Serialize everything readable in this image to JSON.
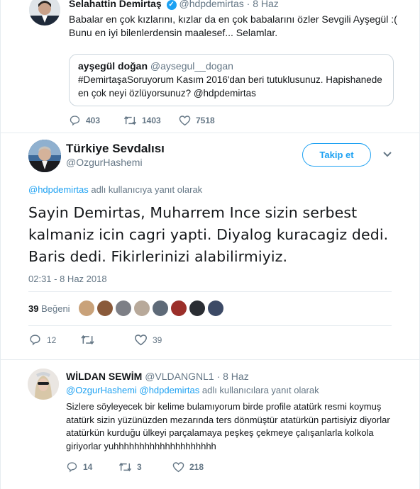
{
  "parent_tweet": {
    "name": "Selahattin Demirtaş",
    "verified_icon": "verified-badge-icon",
    "handle": "@hdpdemirtas",
    "date": "· 8 Haz",
    "text": "Babalar en çok kızlarını, kızlar da en çok babalarını özler Sevgili Ayşegül :( Bunu en iyi bilenlerdensin maalesef... Selamlar.",
    "quote": {
      "name": "ayşegül doğan",
      "handle": "@aysegul__dogan",
      "text": "#DemirtaşaSoruyorum Kasım 2016'dan beri tutuklusunuz. Hapishanede en çok neyi özlüyorsunuz? @hdpdemirtas"
    },
    "replies": "403",
    "retweets": "1403",
    "likes": "7518"
  },
  "main_tweet": {
    "name": "Türkiye Sevdalısı",
    "handle": "@OzgurHashemi",
    "follow_label": "Takip et",
    "reply_to_handle": "@hdpdemirtas",
    "reply_to_suffix": " adlı kullanıcıya yanıt olarak",
    "text": "Sayin Demirtas, Muharrem Ince sizin serbest kalmaniz icin cagri yapti. Diyalog kuracagiz dedi. Baris dedi.  Fikirlerinizi alabilirmiyiz.",
    "timestamp": "02:31 - 8 Haz 2018",
    "like_count": "39",
    "like_label": " Beğeni",
    "replies": "12",
    "retweets": "",
    "likes": "39"
  },
  "reply_tweet": {
    "name": "WİLDAN SEWİM",
    "handle": "@VLDANGNL1",
    "date": "· 8 Haz",
    "reply_to_handles": "@OzgurHashemi @hdpdemirtas",
    "reply_to_suffix": " adlı kullanıcılara yanıt olarak",
    "text": "Sizlere söyleyecek bir kelime bulamıyorum birde profile atatürk resmi koymuş atatürk sizin yüzünüzden mezarında ters dönmüştür atatürkün partisiyiz diyorlar atatürkün kurduğu ülkeyi parçalamaya peşkeş çekmeye çalışanlarla kolkola giriyorlar yuhhhhhhhhhhhhhhhhhhhh",
    "replies": "14",
    "retweets": "3",
    "likes": "218"
  },
  "colors": {
    "accent": "#1da1f2",
    "muted": "#657786",
    "border": "#e6ecf0"
  }
}
